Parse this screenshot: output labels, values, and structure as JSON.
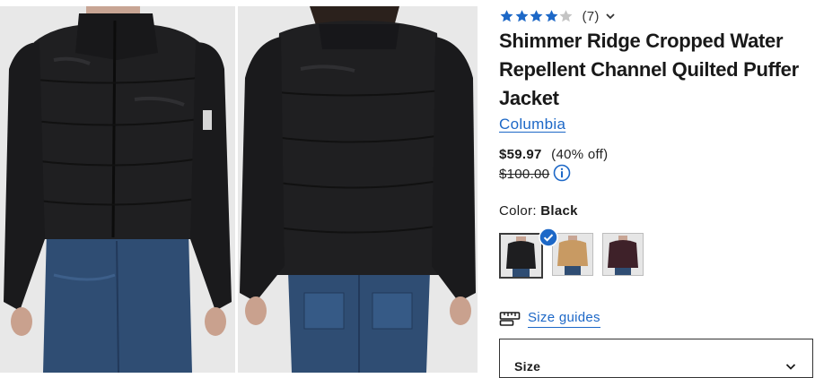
{
  "product": {
    "review_count": "(7)",
    "rating": 4,
    "rating_max": 5,
    "title": "Shimmer Ridge Cropped Water Repellent Channel Quilted Puffer Jacket",
    "brand": "Columbia",
    "sale_price": "$59.97",
    "discount": "(40% off)",
    "original_price": "$100.00",
    "color_label": "Color:",
    "color_value": "Black",
    "swatches": [
      {
        "name": "Black",
        "hex": "#1e1e20",
        "selected": true
      },
      {
        "name": "Tan",
        "hex": "#c89a63",
        "selected": false
      },
      {
        "name": "Burgundy",
        "hex": "#3e2129",
        "selected": false
      }
    ],
    "size_guides_label": "Size guides",
    "size_label": "Size"
  },
  "colors": {
    "accent": "#1d68c7",
    "star": "#1d68c7",
    "star_empty": "#c4c4c4",
    "text": "#1b1b1b"
  },
  "icons": {
    "stars": "star-icon",
    "dropdown": "chevron-down-icon",
    "info": "info-icon",
    "selected": "check-icon",
    "size_guide": "ruler-icon"
  }
}
